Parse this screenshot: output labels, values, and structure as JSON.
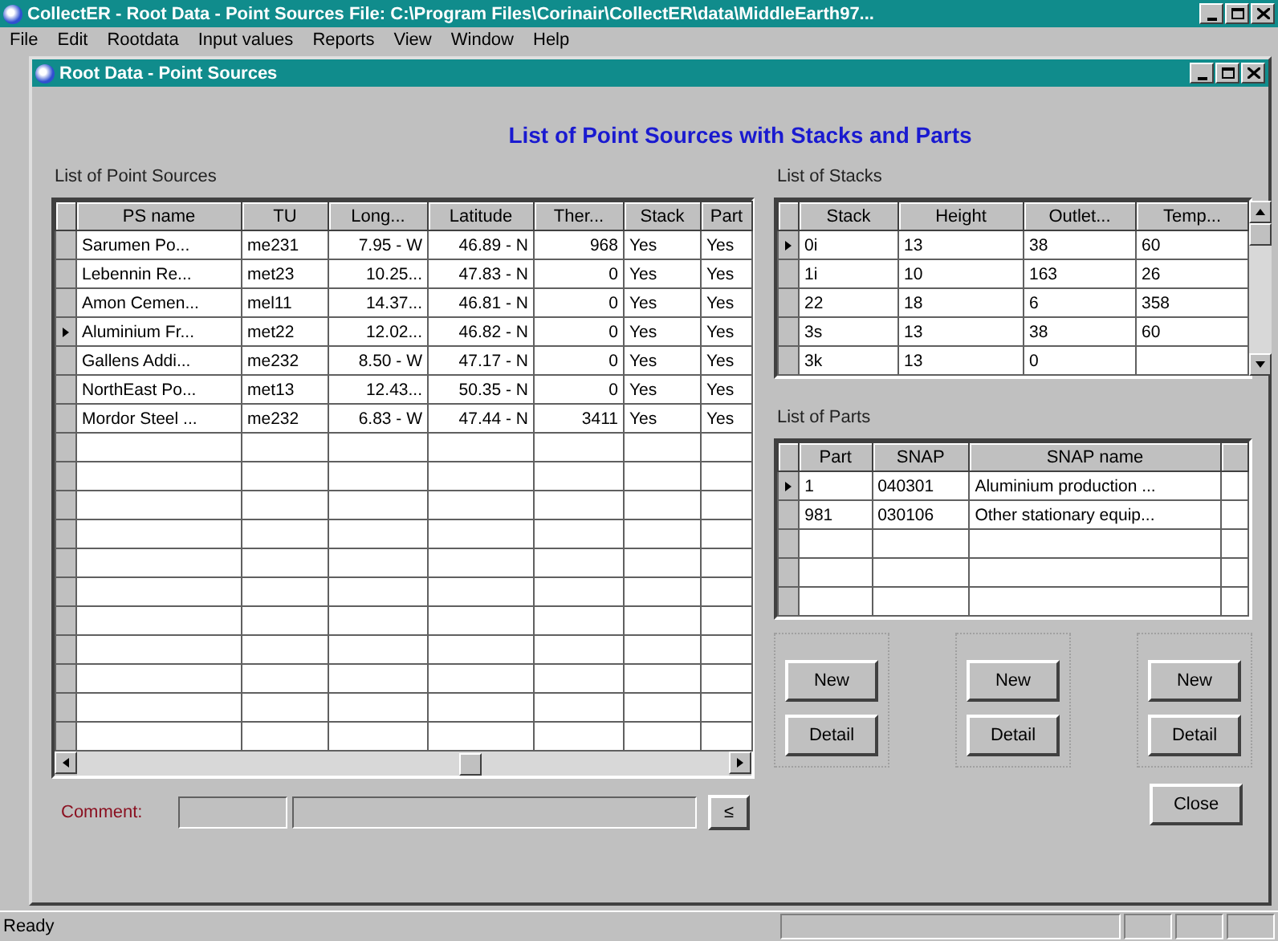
{
  "window": {
    "title": "CollectER - Root Data - Point Sources  File: C:\\Program Files\\Corinair\\CollectER\\data\\MiddleEarth97..."
  },
  "menu": [
    "File",
    "Edit",
    "Rootdata",
    "Input values",
    "Reports",
    "View",
    "Window",
    "Help"
  ],
  "child_window": {
    "title": "Root Data - Point Sources"
  },
  "heading": "List of Point Sources with Stacks and Parts",
  "point_sources": {
    "label": "List of Point Sources",
    "columns": [
      "PS name",
      "TU",
      "Long...",
      "Latitude",
      "Ther...",
      "Stack",
      "Part"
    ],
    "rows": [
      {
        "selected": false,
        "cells": [
          "Sarumen Po...",
          "me231",
          "7.95 - W",
          "46.89 - N",
          "968",
          "Yes",
          "Yes"
        ]
      },
      {
        "selected": false,
        "cells": [
          "Lebennin Re...",
          "met23",
          "10.25...",
          "47.83 - N",
          "0",
          "Yes",
          "Yes"
        ]
      },
      {
        "selected": false,
        "cells": [
          "Amon Cemen...",
          "mel11",
          "14.37...",
          "46.81 - N",
          "0",
          "Yes",
          "Yes"
        ]
      },
      {
        "selected": true,
        "cells": [
          "Aluminium Fr...",
          "met22",
          "12.02...",
          "46.82 - N",
          "0",
          "Yes",
          "Yes"
        ]
      },
      {
        "selected": false,
        "cells": [
          "Gallens Addi...",
          "me232",
          "8.50 - W",
          "47.17 - N",
          "0",
          "Yes",
          "Yes"
        ]
      },
      {
        "selected": false,
        "cells": [
          "NorthEast Po...",
          "met13",
          "12.43...",
          "50.35 - N",
          "0",
          "Yes",
          "Yes"
        ]
      },
      {
        "selected": false,
        "cells": [
          "Mordor Steel ...",
          "me232",
          "6.83 - W",
          "47.44 - N",
          "3411",
          "Yes",
          "Yes"
        ]
      }
    ]
  },
  "comment": {
    "label": "Comment:",
    "button": "≤"
  },
  "stacks": {
    "label": "List of Stacks",
    "columns": [
      "Stack",
      "Height",
      "Outlet...",
      "Temp..."
    ],
    "rows": [
      {
        "selected": true,
        "cells": [
          "0i",
          "13",
          "38",
          "60"
        ]
      },
      {
        "selected": false,
        "cells": [
          "1i",
          "10",
          "163",
          "26"
        ]
      },
      {
        "selected": false,
        "cells": [
          "22",
          "18",
          "6",
          "358"
        ]
      },
      {
        "selected": false,
        "cells": [
          "3s",
          "13",
          "38",
          "60"
        ]
      },
      {
        "selected": false,
        "cells": [
          "3k",
          "13",
          "0",
          ""
        ]
      }
    ]
  },
  "parts": {
    "label": "List of Parts",
    "columns": [
      "Part",
      "SNAP",
      "SNAP name"
    ],
    "rows": [
      {
        "selected": true,
        "cells": [
          "1",
          "040301",
          "Aluminium production ..."
        ]
      },
      {
        "selected": false,
        "cells": [
          "981",
          "030106",
          "Other stationary equip..."
        ]
      }
    ]
  },
  "button_groups": [
    [
      "New",
      "Detail"
    ],
    [
      "New",
      "Detail"
    ],
    [
      "New",
      "Detail"
    ]
  ],
  "close_button": "Close",
  "status_bar": {
    "text": "Ready"
  }
}
